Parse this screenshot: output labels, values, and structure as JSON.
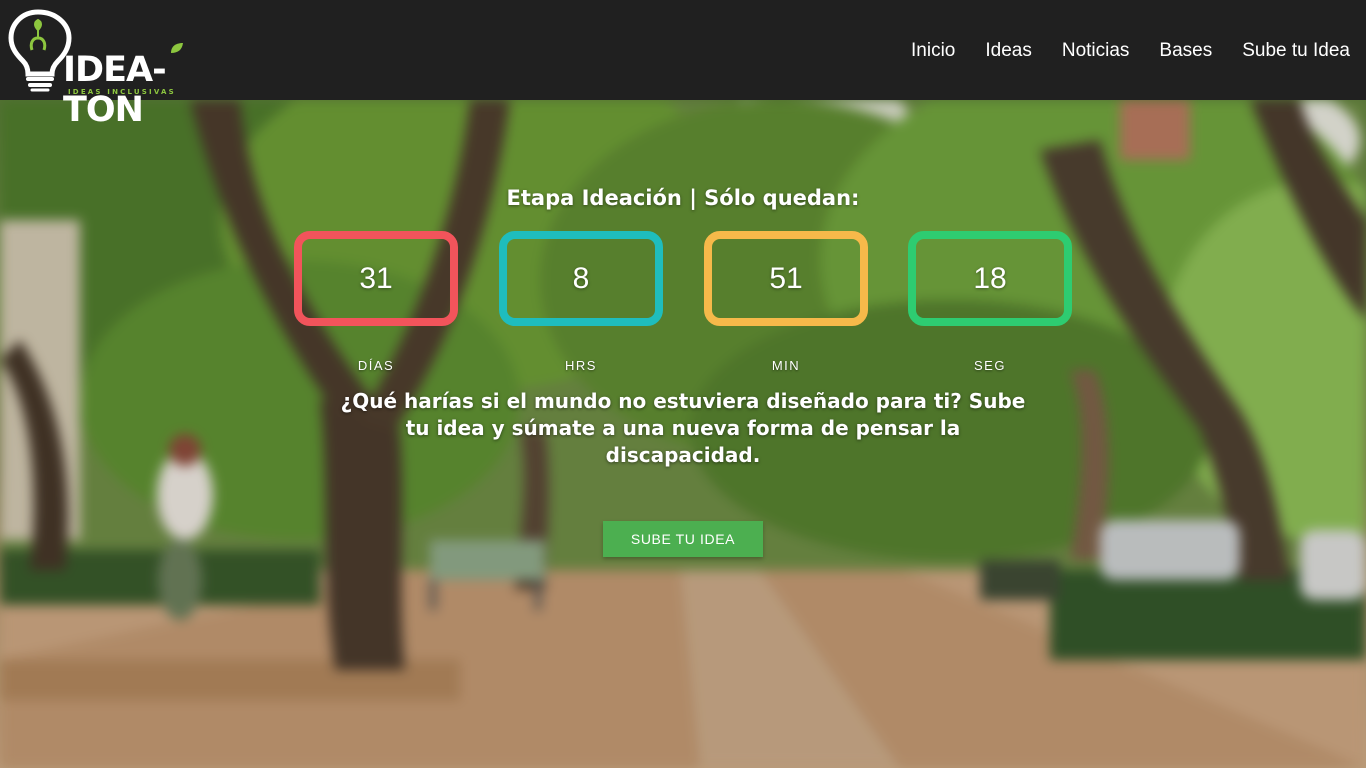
{
  "header": {
    "logo_text": "IDEA-TON",
    "logo_subtitle": "IDEAS INCLUSIVAS",
    "nav": [
      "Inicio",
      "Ideas",
      "Noticias",
      "Bases",
      "Sube tu Idea"
    ]
  },
  "hero": {
    "stage_title": "Etapa Ideación | Sólo quedan:",
    "countdown": [
      {
        "value": "31",
        "label": "DÍAS",
        "color": "#f2545b"
      },
      {
        "value": "8",
        "label": "HRS",
        "color": "#1fbdbd"
      },
      {
        "value": "51",
        "label": "MIN",
        "color": "#f6b94a"
      },
      {
        "value": "18",
        "label": "SEG",
        "color": "#2ecc71"
      }
    ],
    "tagline": "¿Qué harías si el mundo no estuviera diseñado para ti? Sube tu idea y súmate a una nueva forma de pensar la discapacidad.",
    "cta_label": "SUBE TU IDEA"
  },
  "colors": {
    "navbar": "#202020",
    "brand_green": "#8dc63f",
    "cta_green": "#4caf50"
  },
  "icons": {
    "logo": "lightbulb-icon"
  }
}
